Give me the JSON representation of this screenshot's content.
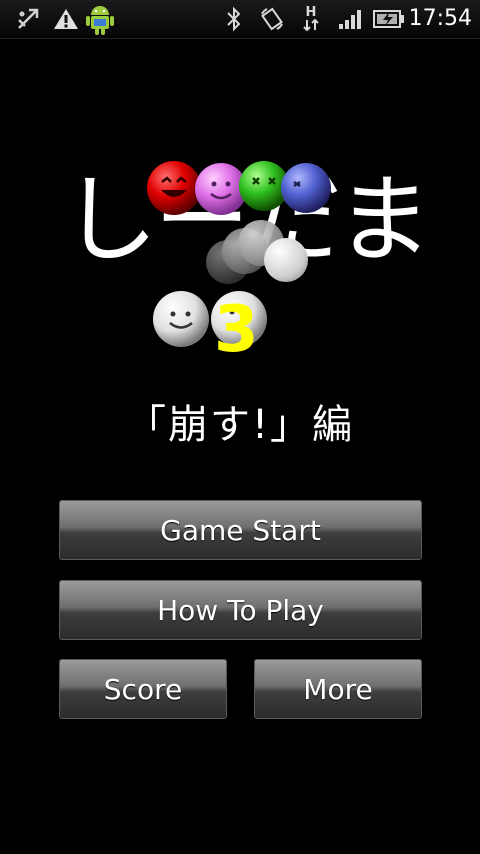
{
  "status_bar": {
    "time": "17:54",
    "icons": [
      "usb-debug-icon",
      "warning-icon",
      "android-icon",
      "bluetooth-icon",
      "rotation-icon",
      "data-h-icon",
      "signal-icon",
      "battery-charging-icon"
    ],
    "data_label": "H"
  },
  "logo": {
    "title": "しーだま",
    "number": "3",
    "subtitle": "「崩す!」編",
    "ball_colors": {
      "red": "#e00000",
      "pink": "#e070e8",
      "green": "#30c020",
      "blue": "#5060d0",
      "white": "#ffffff",
      "number": "#ffff00"
    }
  },
  "menu": {
    "game_start": "Game Start",
    "how_to_play": "How To Play",
    "score": "Score",
    "more": "More"
  }
}
